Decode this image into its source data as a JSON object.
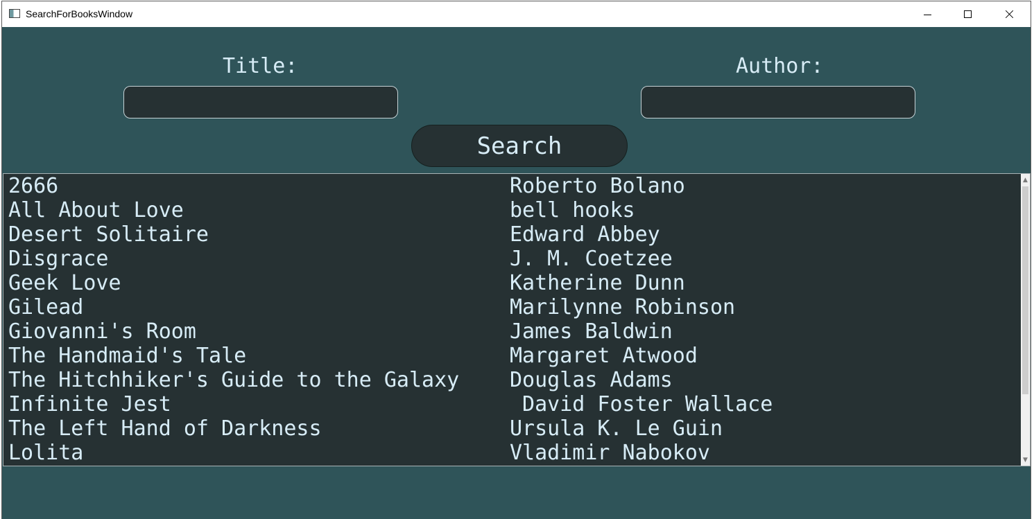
{
  "window": {
    "title": "SearchForBooksWindow",
    "background_color": "#2f5459",
    "panel_color": "#263133",
    "text_color": "#d7ecf6",
    "icons": {
      "app": "app-window-icon",
      "minimize": "minimize-icon",
      "maximize": "maximize-icon",
      "close": "close-icon"
    }
  },
  "search_form": {
    "title_label": "Title:",
    "author_label": "Author:",
    "title_value": "",
    "author_value": "",
    "search_button_label": "Search"
  },
  "results": {
    "rows": [
      {
        "title": "2666",
        "author": "Roberto Bolano"
      },
      {
        "title": "All About Love",
        "author": "bell hooks"
      },
      {
        "title": "Desert Solitaire",
        "author": "Edward Abbey"
      },
      {
        "title": "Disgrace",
        "author": "J. M. Coetzee"
      },
      {
        "title": "Geek Love",
        "author": "Katherine Dunn"
      },
      {
        "title": "Gilead",
        "author": "Marilynne Robinson"
      },
      {
        "title": "Giovanni's Room",
        "author": "James Baldwin"
      },
      {
        "title": "The Handmaid's Tale",
        "author": "Margaret Atwood"
      },
      {
        "title": "The Hitchhiker's Guide to the Galaxy",
        "author": "Douglas Adams"
      },
      {
        "title": "Infinite Jest",
        "author": " David Foster Wallace"
      },
      {
        "title": "The Left Hand of Darkness",
        "author": "Ursula K. Le Guin"
      },
      {
        "title": "Lolita",
        "author": "Vladimir Nabokov"
      }
    ],
    "scroll_up_icon": "▲",
    "scroll_down_icon": "▼"
  }
}
